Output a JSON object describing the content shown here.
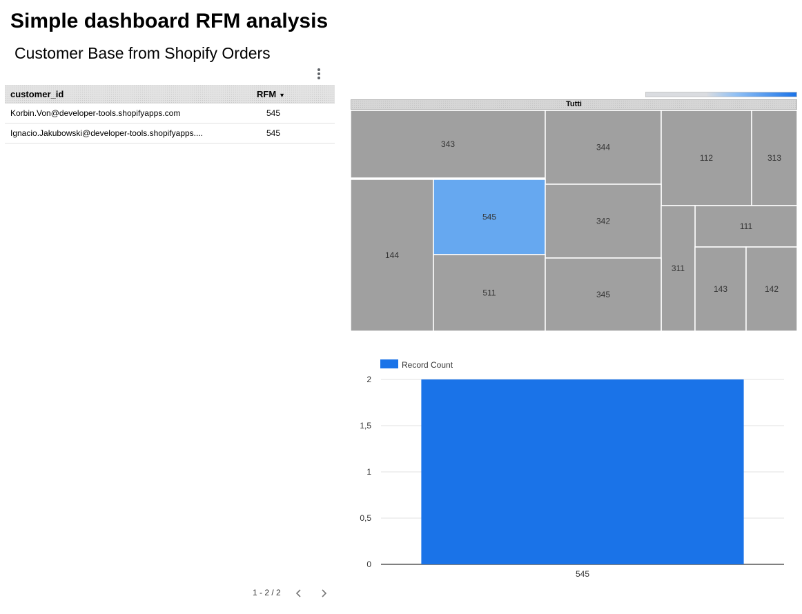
{
  "title": "Simple dashboard RFM analysis",
  "subtitle": "Customer Base from Shopify Orders",
  "table": {
    "columns": [
      "customer_id",
      "RFM"
    ],
    "sort_indicator": "▼",
    "rows": [
      {
        "customer_id": "Korbin.Von@developer-tools.shopifyapps.com",
        "rfm": "545"
      },
      {
        "customer_id": "Ignacio.Jakubowski@developer-tools.shopifyapps....",
        "rfm": "545"
      }
    ],
    "pagination": "1 - 2 / 2"
  },
  "treemap": {
    "root_label": "Tutti",
    "highlighted": "545",
    "colors": {
      "default": "#a0a0a0",
      "highlight": "#66a8f0",
      "border": "#ffffff"
    },
    "cells": [
      "343",
      "344",
      "112",
      "313",
      "144",
      "545",
      "342",
      "111",
      "311",
      "511",
      "345",
      "143",
      "142"
    ]
  },
  "chart_data": {
    "type": "bar",
    "categories": [
      "545"
    ],
    "series": [
      {
        "name": "Record Count",
        "values": [
          2
        ]
      }
    ],
    "ylim": [
      0,
      2
    ],
    "yticks": [
      "0",
      "0,5",
      "1",
      "1,5",
      "2"
    ],
    "ytick_values": [
      0,
      0.5,
      1,
      1.5,
      2
    ],
    "legend_position": "top-left",
    "grid": true,
    "color": "#1a73e8"
  }
}
